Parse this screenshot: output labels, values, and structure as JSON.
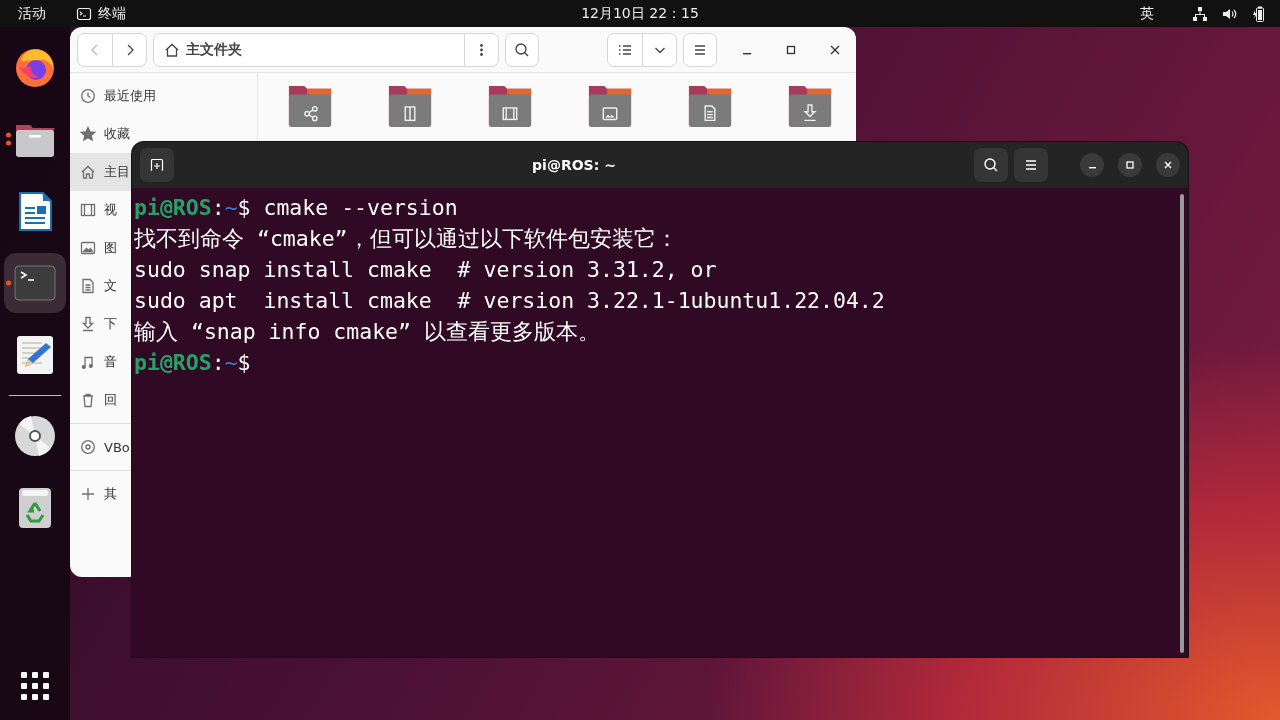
{
  "top_bar": {
    "activities": "活动",
    "app_label": "终端",
    "clock": "12月10日  22：15",
    "input_method": "英"
  },
  "dock": {
    "favorites": [
      {
        "kind": "firefox",
        "running": false,
        "selected": false
      },
      {
        "kind": "files",
        "running": true,
        "multiple_windows": true,
        "selected": false
      },
      {
        "kind": "writer",
        "running": false,
        "selected": false
      },
      {
        "kind": "terminal",
        "running": true,
        "multiple_windows": false,
        "selected": true
      },
      {
        "kind": "editor",
        "running": false,
        "selected": false
      }
    ],
    "others": [
      {
        "kind": "disc",
        "running": false,
        "selected": false
      },
      {
        "kind": "trash",
        "running": false,
        "selected": false
      }
    ]
  },
  "files_window": {
    "path": "主文件夹",
    "sidebar": {
      "sections": [
        {
          "items": [
            {
              "kind": "recent",
              "label": "最近使用",
              "selected": false
            },
            {
              "kind": "star",
              "label": "收藏",
              "selected": false
            },
            {
              "kind": "home",
              "label": "主目",
              "selected": true
            },
            {
              "kind": "video",
              "label": "视",
              "selected": false
            },
            {
              "kind": "picture",
              "label": "图",
              "selected": false
            },
            {
              "kind": "document",
              "label": "文",
              "selected": false
            },
            {
              "kind": "download",
              "label": "下",
              "selected": false
            },
            {
              "kind": "music",
              "label": "音",
              "selected": false
            },
            {
              "kind": "trash",
              "label": "回",
              "selected": false
            }
          ]
        },
        {
          "items": [
            {
              "kind": "disc",
              "label": "VBo",
              "selected": false
            }
          ]
        },
        {
          "items": [
            {
              "kind": "plus",
              "label": "其",
              "selected": false
            }
          ]
        }
      ]
    },
    "folders": [
      {
        "kind": "share"
      },
      {
        "kind": "template"
      },
      {
        "kind": "video"
      },
      {
        "kind": "picture"
      },
      {
        "kind": "document"
      },
      {
        "kind": "download"
      }
    ]
  },
  "terminal": {
    "title": "pi@ROS: ~",
    "lines": [
      {
        "kind": "prompt",
        "user": "pi@ROS",
        "colon": ":",
        "path": "~",
        "text": "$ cmake --version"
      },
      {
        "kind": "output",
        "text": "找不到命令 “cmake”，但可以通过以下软件包安装它："
      },
      {
        "kind": "output",
        "text": "sudo snap install cmake  # version 3.31.2, or"
      },
      {
        "kind": "output",
        "text": "sudo apt  install cmake  # version 3.22.1-1ubuntu1.22.04.2"
      },
      {
        "kind": "output",
        "text": "输入 “snap info cmake” 以查看更多版本。"
      },
      {
        "kind": "prompt",
        "user": "pi@ROS",
        "colon": ":",
        "path": "~",
        "text": "$"
      }
    ]
  }
}
